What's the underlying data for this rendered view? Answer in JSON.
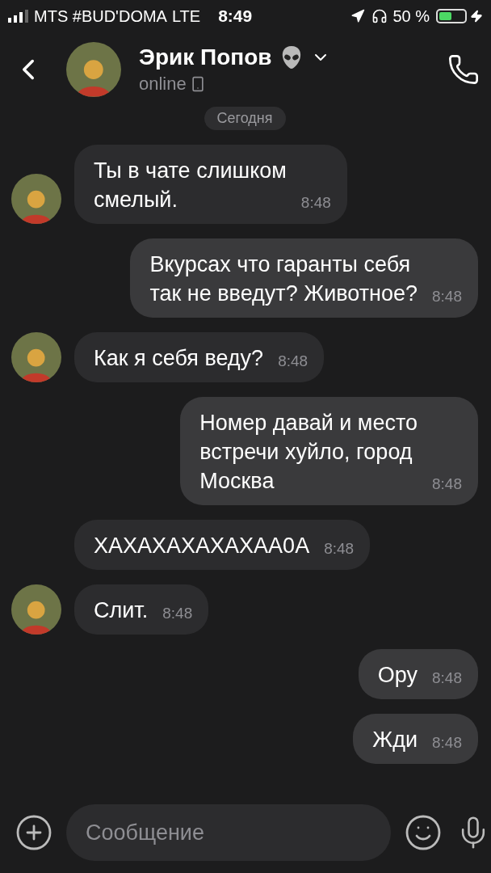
{
  "status_bar": {
    "carrier": "MTS #BUD'DOMA",
    "network": "LTE",
    "time": "8:49",
    "battery": "50 %"
  },
  "header": {
    "name": "Эрик Попов",
    "status": "online"
  },
  "date_label": "Сегодня",
  "messages": [
    {
      "kind": "incoming",
      "avatar": true,
      "text": "Ты в чате слишком\nсмелый.",
      "time": "8:48"
    },
    {
      "kind": "outgoing",
      "text": "Вкурсах что гаранты себя\nтак не введут? Животное?",
      "time": "8:48"
    },
    {
      "kind": "incoming",
      "avatar": true,
      "text": "Как я себя веду?",
      "time": "8:48"
    },
    {
      "kind": "outgoing",
      "text": "Номер давай и место\nвстречи хуйло, город\nМосква",
      "time": "8:48"
    },
    {
      "kind": "incoming",
      "avatar": false,
      "text": "ХАХАХАХАХАХАА0А",
      "time": "8:48"
    },
    {
      "kind": "incoming",
      "avatar": true,
      "text": "Слит.",
      "time": "8:48"
    },
    {
      "kind": "outgoing",
      "text": "Ору",
      "time": "8:48"
    },
    {
      "kind": "outgoing",
      "text": "Жди",
      "time": "8:48"
    }
  ],
  "composer": {
    "placeholder": "Сообщение"
  }
}
